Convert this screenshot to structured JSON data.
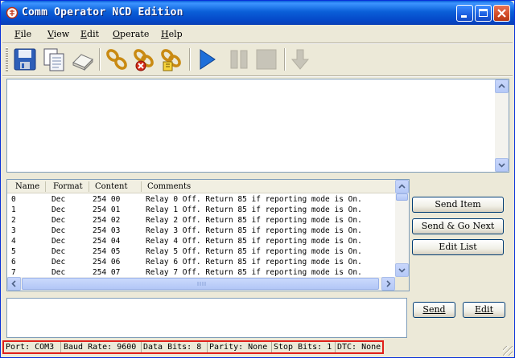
{
  "window": {
    "title": "Comm Operator NCD Edition"
  },
  "menu": [
    {
      "key": "F",
      "rest": "ile"
    },
    {
      "key": "V",
      "rest": "iew"
    },
    {
      "key": "E",
      "rest": "dit"
    },
    {
      "key": "O",
      "rest": "perate"
    },
    {
      "key": "H",
      "rest": "elp"
    }
  ],
  "toolbar": {
    "icons": [
      "save-icon",
      "copy-icon",
      "eraser-icon",
      "connect-icon",
      "disconnect-icon",
      "connect-settings-icon",
      "play-icon",
      "pause-icon",
      "stop-icon",
      "download-arrow-icon"
    ]
  },
  "list": {
    "headers": [
      "Name",
      "Format",
      "Content",
      "Comments"
    ],
    "rows": [
      {
        "name": "0",
        "format": "Dec",
        "content": "254 00",
        "comment": "Relay 0 Off. Return 85 if reporting mode is On."
      },
      {
        "name": "1",
        "format": "Dec",
        "content": "254 01",
        "comment": "Relay 1 Off. Return 85 if reporting mode is On."
      },
      {
        "name": "2",
        "format": "Dec",
        "content": "254 02",
        "comment": "Relay 2 Off. Return 85 if reporting mode is On."
      },
      {
        "name": "3",
        "format": "Dec",
        "content": "254 03",
        "comment": "Relay 3 Off. Return 85 if reporting mode is On."
      },
      {
        "name": "4",
        "format": "Dec",
        "content": "254 04",
        "comment": "Relay 4 Off. Return 85 if reporting mode is On."
      },
      {
        "name": "5",
        "format": "Dec",
        "content": "254 05",
        "comment": "Relay 5 Off. Return 85 if reporting mode is On."
      },
      {
        "name": "6",
        "format": "Dec",
        "content": "254 06",
        "comment": "Relay 6 Off. Return 85 if reporting mode is On."
      },
      {
        "name": "7",
        "format": "Dec",
        "content": "254 07",
        "comment": "Relay 7 Off. Return 85 if reporting mode is On."
      }
    ]
  },
  "buttons": {
    "send_item": "Send Item",
    "send_go_next": "Send & Go Next",
    "edit_list": "Edit List",
    "send": "Send",
    "edit": "Edit"
  },
  "status": {
    "port": "Port: COM3",
    "baud": "Baud Rate: 9600",
    "data_bits": "Data Bits: 8",
    "parity": "Parity: None",
    "stop_bits": "Stop Bits: 1",
    "dtc": "DTC: None"
  },
  "colors": {
    "titlebar": "#0a5fd8",
    "status_highlight": "#e0201a",
    "button_border": "#003c74"
  }
}
